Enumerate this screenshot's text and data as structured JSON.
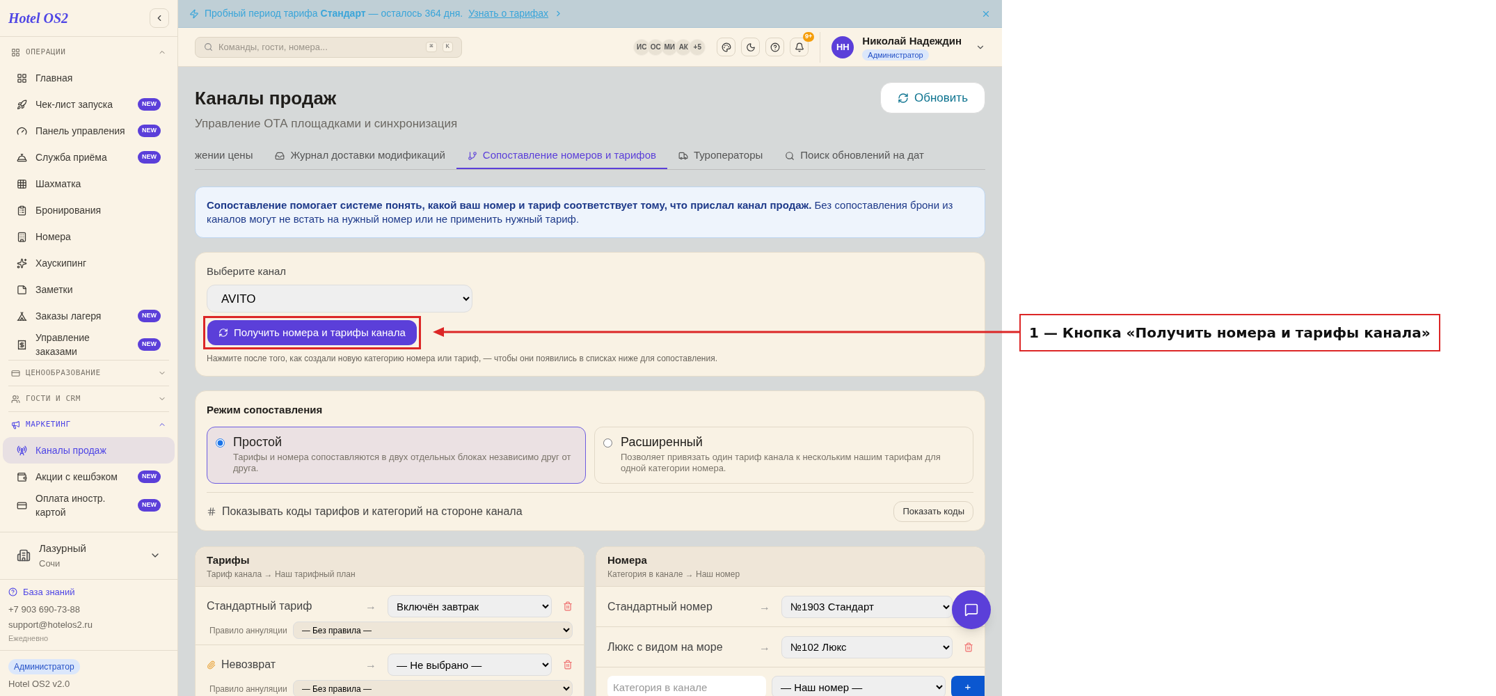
{
  "sidebar": {
    "logo": "Hotel OS2",
    "sections": [
      {
        "label": "ОПЕРАЦИИ",
        "expanded": true,
        "active": false,
        "items": [
          {
            "label": "Главная",
            "selected": false
          },
          {
            "label": "Чек-лист запуска",
            "badge": "NEW",
            "selected": false
          },
          {
            "label": "Панель управления",
            "badge": "NEW",
            "selected": false
          },
          {
            "label": "Служба приёма",
            "badge": "NEW",
            "selected": false
          },
          {
            "label": "Шахматка",
            "selected": false
          },
          {
            "label": "Бронирования",
            "selected": false
          },
          {
            "label": "Номера",
            "selected": false
          },
          {
            "label": "Хаускипинг",
            "selected": false
          },
          {
            "label": "Заметки",
            "selected": false
          },
          {
            "label": "Заказы лагеря",
            "badge": "NEW",
            "selected": false
          },
          {
            "label": "Управление заказами",
            "badge": "NEW",
            "selected": false
          }
        ]
      },
      {
        "label": "ЦЕНООБРАЗОВАНИЕ",
        "expanded": false,
        "active": false
      },
      {
        "label": "ГОСТИ И CRM",
        "expanded": false,
        "active": false
      },
      {
        "label": "МАРКЕТИНГ",
        "expanded": true,
        "active": true,
        "items": [
          {
            "label": "Каналы продаж",
            "selected": true
          },
          {
            "label": "Акции с кешбэком",
            "badge": "NEW",
            "selected": false
          },
          {
            "label": "Оплата иностр. картой",
            "badge": "NEW",
            "selected": false
          }
        ]
      }
    ],
    "hotel": {
      "name": "Лазурный",
      "city": "Сочи"
    },
    "help": {
      "link": "База знаний",
      "phone": "+7 903 690-73-88",
      "email": "support@hotelos2.ru",
      "hours": "Ежедневно"
    },
    "role": "Администратор",
    "version": "Hotel OS2 v2.0"
  },
  "banner": {
    "text": "Пробный период тарифа **Стандарт** — осталось 364 дня.",
    "link": "Узнать о тарифах"
  },
  "topbar": {
    "search": {
      "placeholder": "Команды, гости, номера...",
      "keys": [
        "⌘",
        "K"
      ]
    },
    "avatars": [
      "ИС",
      "ОС",
      "МИ",
      "АК",
      "+5"
    ],
    "notifications": "9+",
    "user": {
      "initials": "НН",
      "name": "Николай Надеждин",
      "role": "Администратор"
    }
  },
  "page": {
    "title": "Каналы продаж",
    "subtitle": "Управление ОТА площадками и синхронизация",
    "refresh": "Обновить"
  },
  "tabs": [
    {
      "label": "жении цены",
      "selected": false
    },
    {
      "label": "Журнал доставки модификаций",
      "selected": false
    },
    {
      "label": "Сопоставление номеров и тарифов",
      "selected": true
    },
    {
      "label": "Туроператоры",
      "selected": false
    },
    {
      "label": "Поиск обновлений на дат",
      "selected": false
    }
  ],
  "info": "**Сопоставление помогает системе понять, какой ваш номер и тариф соответствует тому, что прислал канал продаж.** Без сопоставления брони из каналов могут не встать на нужный номер или не применить нужный тариф.",
  "channel": {
    "label": "Выберите канал",
    "value": "AVITO",
    "button": "Получить номера и тарифы канала",
    "hint": "Нажмите после того, как создали новую категорию номера или тариф, — чтобы они появились в списках ниже для сопоставления."
  },
  "mode": {
    "title": "Режим сопоставления",
    "options": [
      {
        "title": "Простой",
        "description": "Тарифы и номера сопоставляются в двух отдельных блоках независимо друг от друга.",
        "selected": true
      },
      {
        "title": "Расширенный",
        "description": "Позволяет привязать один тариф канала к нескольким нашим тарифам для одной категории номера.",
        "selected": false
      }
    ],
    "codes_label": "Показывать коды тарифов и категорий на стороне канала",
    "codes_button": "Показать коды"
  },
  "tariffs": {
    "title": "Тарифы",
    "subtitle": "Тариф канала → Наш тарифный план",
    "rows": [
      {
        "kind": "plain",
        "name": "Стандартный тариф",
        "arrow": "→",
        "value": "Включён завтрак",
        "rule_label": "Правило аннуляции",
        "rule_value": "— Без правила —"
      },
      {
        "kind": "linked",
        "name": "Невозврат",
        "arrow": "→",
        "value": "— Не выбрано —",
        "rule_label": "Правило аннуляции",
        "rule_value": "— Без правила —"
      }
    ]
  },
  "rooms": {
    "title": "Номера",
    "subtitle": "Категория в канале → Наш номер",
    "rows": [
      {
        "name": "Стандартный номер",
        "arrow": "→",
        "value": "№1903 Стандарт"
      },
      {
        "name": "Люкс с видом на море",
        "arrow": "→",
        "value": "№102 Люкс"
      }
    ],
    "new_row": {
      "placeholder": "Категория в канале",
      "value": "— Наш номер —",
      "add": "+"
    }
  },
  "annotation": {
    "label": "1 — Кнопка «Получить номера и тарифы канала»"
  }
}
